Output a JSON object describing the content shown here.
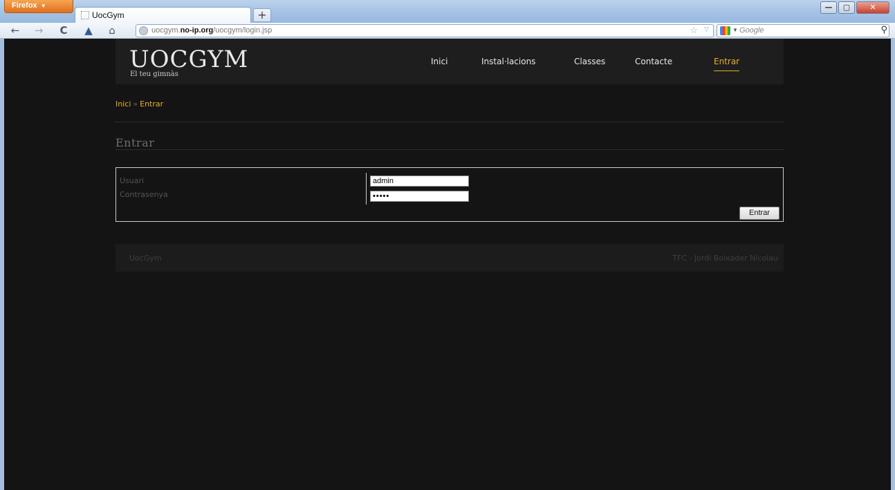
{
  "browser": {
    "app_button": "Firefox",
    "tab_title": "UocGym",
    "new_tab": "+",
    "url_prefix": "uocgym.",
    "url_host": "no-ip.org",
    "url_path": "/uocgym/login.jsp",
    "search_placeholder": "Google",
    "icons": {
      "back": "←",
      "forward": "→",
      "reload": "C",
      "bookmark": "▲",
      "home": "⌂",
      "star": "☆",
      "dropdown": "▽",
      "search": "⚲",
      "minimize": "—",
      "maximize": "▢",
      "close": "✕"
    }
  },
  "site": {
    "logo_title": "UOCGYM",
    "logo_subtitle": "El teu gimnàs",
    "menu": [
      {
        "label": "Inici"
      },
      {
        "label": "Instal·lacions"
      },
      {
        "label": "Classes"
      },
      {
        "label": "Contacte"
      },
      {
        "label": "Entrar",
        "active": true
      }
    ],
    "breadcrumb": {
      "home": "Inici",
      "separator": "»",
      "current": "Entrar"
    },
    "page_title": "Entrar",
    "login": {
      "user_label": "Usuari",
      "user_value": "admin",
      "password_label": "Contrasenya",
      "password_value": "•••••",
      "submit_label": "Entrar"
    },
    "footer": {
      "left": "UocGym",
      "right": "TFC - Jordi Boixader Nicolau"
    },
    "colors": {
      "accent": "#e8b12a",
      "background": "#141414",
      "header": "#1e1e1e"
    }
  }
}
